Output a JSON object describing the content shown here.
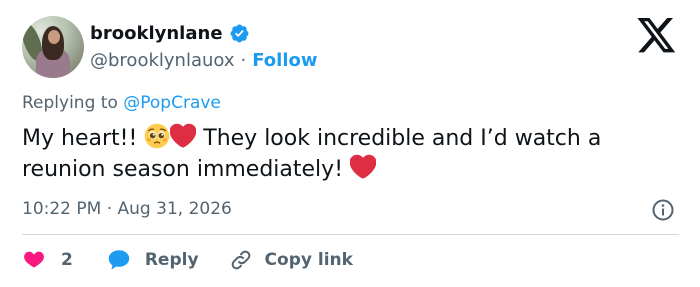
{
  "author": {
    "display_name": "brooklynlane",
    "handle": "@brooklynlauox",
    "follow_label": "Follow",
    "separator": "·",
    "verified_color": "#1d9bf0"
  },
  "reply_context": {
    "prefix": "Replying to ",
    "mention": "@PopCrave"
  },
  "tweet": {
    "text_part1": "My heart!! ",
    "text_part2": " They look incredible and I’d watch a reunion season immediately! ",
    "emojis": [
      "pleading-face-icon",
      "red-heart-icon",
      "red-heart-icon"
    ]
  },
  "meta": {
    "timestamp": "10:22 PM · Aug 31, 2026"
  },
  "actions": {
    "like_count": "2",
    "reply_label": "Reply",
    "copy_label": "Copy link"
  },
  "colors": {
    "accent": "#1d9bf0",
    "like": "#f91880",
    "text": "#0f1419",
    "muted": "#536471",
    "divider": "#cfd9de"
  }
}
